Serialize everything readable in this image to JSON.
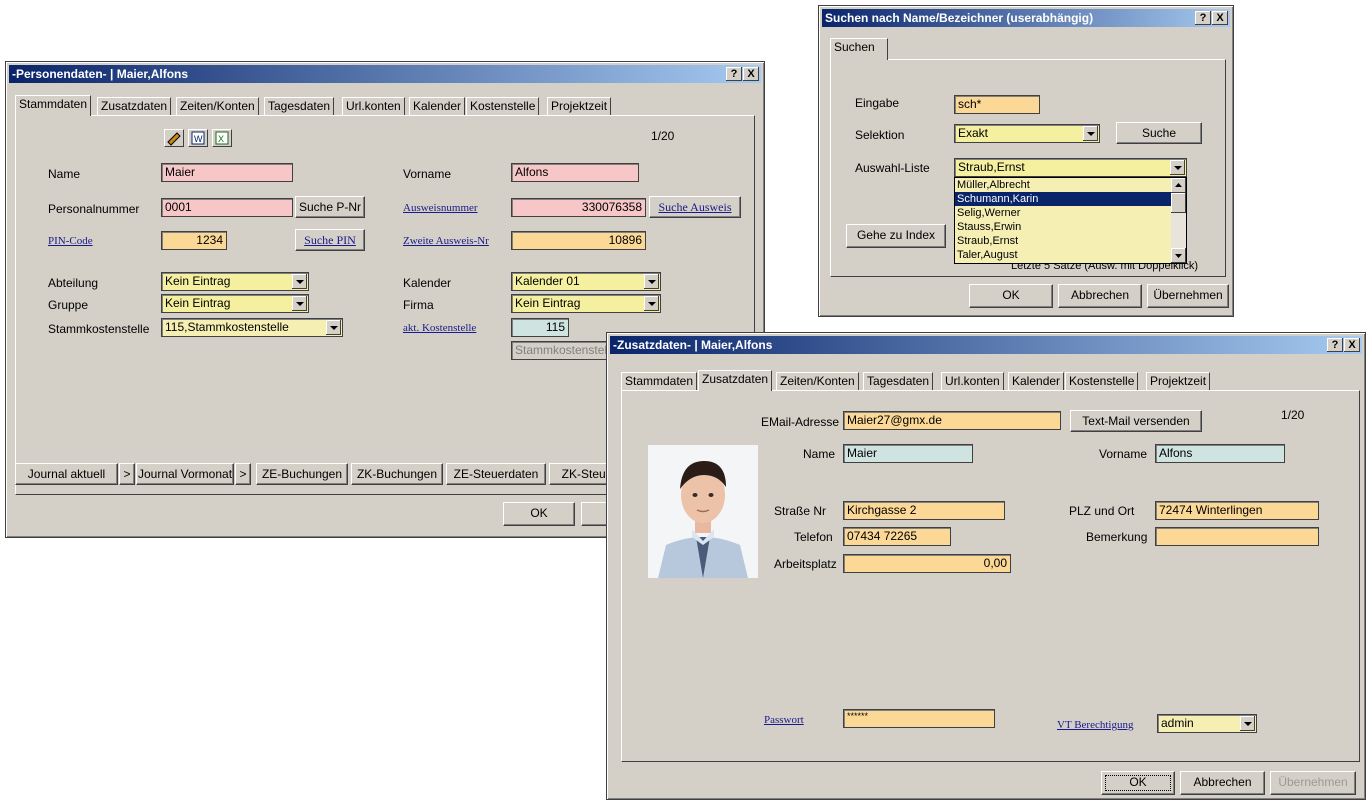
{
  "personal_window": {
    "title": "-Personendaten- | Maier,Alfons",
    "help_btn": "?",
    "close_btn": "X",
    "tabs": [
      "Stammdaten",
      "Zusatzdaten",
      "Zeiten/Konten",
      "Tagesdaten",
      "Url.konten",
      "Kalender",
      "Kostenstelle",
      "Projektzeit"
    ],
    "record_counter": "1/20",
    "name_label": "Name",
    "name_value": "Maier",
    "vorname_label": "Vorname",
    "vorname_value": "Alfons",
    "personalnummer_label": "Personalnummer",
    "personalnummer_value": "0001",
    "suche_pnr_btn": "Suche P-Nr",
    "ausweisnummer_label": "Ausweisnummer",
    "ausweisnummer_value": "330076358",
    "suche_ausweis_btn": "Suche Ausweis",
    "pin_label": "PIN-Code",
    "pin_value": "1234",
    "suche_pin_btn": "Suche PIN",
    "zweite_ausweis_label": "Zweite Ausweis-Nr",
    "zweite_ausweis_value": "10896",
    "abteilung_label": "Abteilung",
    "abteilung_value": "Kein Eintrag",
    "kalender_label": "Kalender",
    "kalender_value": "Kalender 01",
    "gruppe_label": "Gruppe",
    "gruppe_value": "Kein Eintrag",
    "firma_label": "Firma",
    "firma_value": "Kein Eintrag",
    "stammkst_label": "Stammkostenstelle",
    "stammkst_value": "115,Stammkostenstelle",
    "akt_kst_label": "akt. Kostenstelle",
    "akt_kst_value": "115",
    "akt_kst_name": "Stammkostenstell",
    "bottom_buttons": [
      "Journal aktuell",
      ">",
      "Journal Vormonat",
      ">",
      "ZE-Buchungen",
      "ZK-Buchungen",
      "ZE-Steuerdaten",
      "ZK-Steuer"
    ],
    "ok_btn": "OK",
    "a_btn": "A"
  },
  "search_window": {
    "title": "Suchen nach Name/Bezeichner (userabhängig)",
    "help_btn": "?",
    "close_btn": "X",
    "tab": "Suchen",
    "eingabe_label": "Eingabe",
    "eingabe_value": "sch*",
    "selektion_label": "Selektion",
    "selektion_value": "Exakt",
    "suche_btn": "Suche",
    "auswahl_label": "Auswahl-Liste",
    "auswahl_value": "Straub,Ernst",
    "list_items": [
      "Müller,Albrecht",
      "Schumann,Karin",
      "Selig,Werner",
      "Stauss,Erwin",
      "Straub,Ernst",
      "Taler,August"
    ],
    "selected_index": 1,
    "gehe_btn": "Gehe zu Index",
    "hint": "Letzte 5 Sätze (Ausw. mit Doppelklick)",
    "ok_btn": "OK",
    "abbrechen_btn": "Abbrechen",
    "uebernehmen_btn": "Übernehmen"
  },
  "zusatz_window": {
    "title": "-Zusatzdaten- | Maier,Alfons",
    "help_btn": "?",
    "close_btn": "X",
    "tabs": [
      "Stammdaten",
      "Zusatzdaten",
      "Zeiten/Konten",
      "Tagesdaten",
      "Url.konten",
      "Kalender",
      "Kostenstelle",
      "Projektzeit"
    ],
    "record_counter": "1/20",
    "email_label": "EMail-Adresse",
    "email_value": "Maier27@gmx.de",
    "textmail_btn": "Text-Mail versenden",
    "name_label": "Name",
    "name_value": "Maier",
    "vorname_label": "Vorname",
    "vorname_value": "Alfons",
    "strasse_label": "Straße Nr",
    "strasse_value": "Kirchgasse 2",
    "plz_label": "PLZ und Ort",
    "plz_value": "72474 Winterlingen",
    "telefon_label": "Telefon",
    "telefon_value": "07434 72265",
    "bemerkung_label": "Bemerkung",
    "bemerkung_value": "",
    "arbeitsplatz_label": "Arbeitsplatz",
    "arbeitsplatz_value": "0,00",
    "passwort_label": "Passwort",
    "passwort_value": "******",
    "vt_label": "VT Berechtigung",
    "vt_value": "admin",
    "ok_btn": "OK",
    "abbrechen_btn": "Abbrechen",
    "uebernehmen_btn": "Übernehmen"
  }
}
